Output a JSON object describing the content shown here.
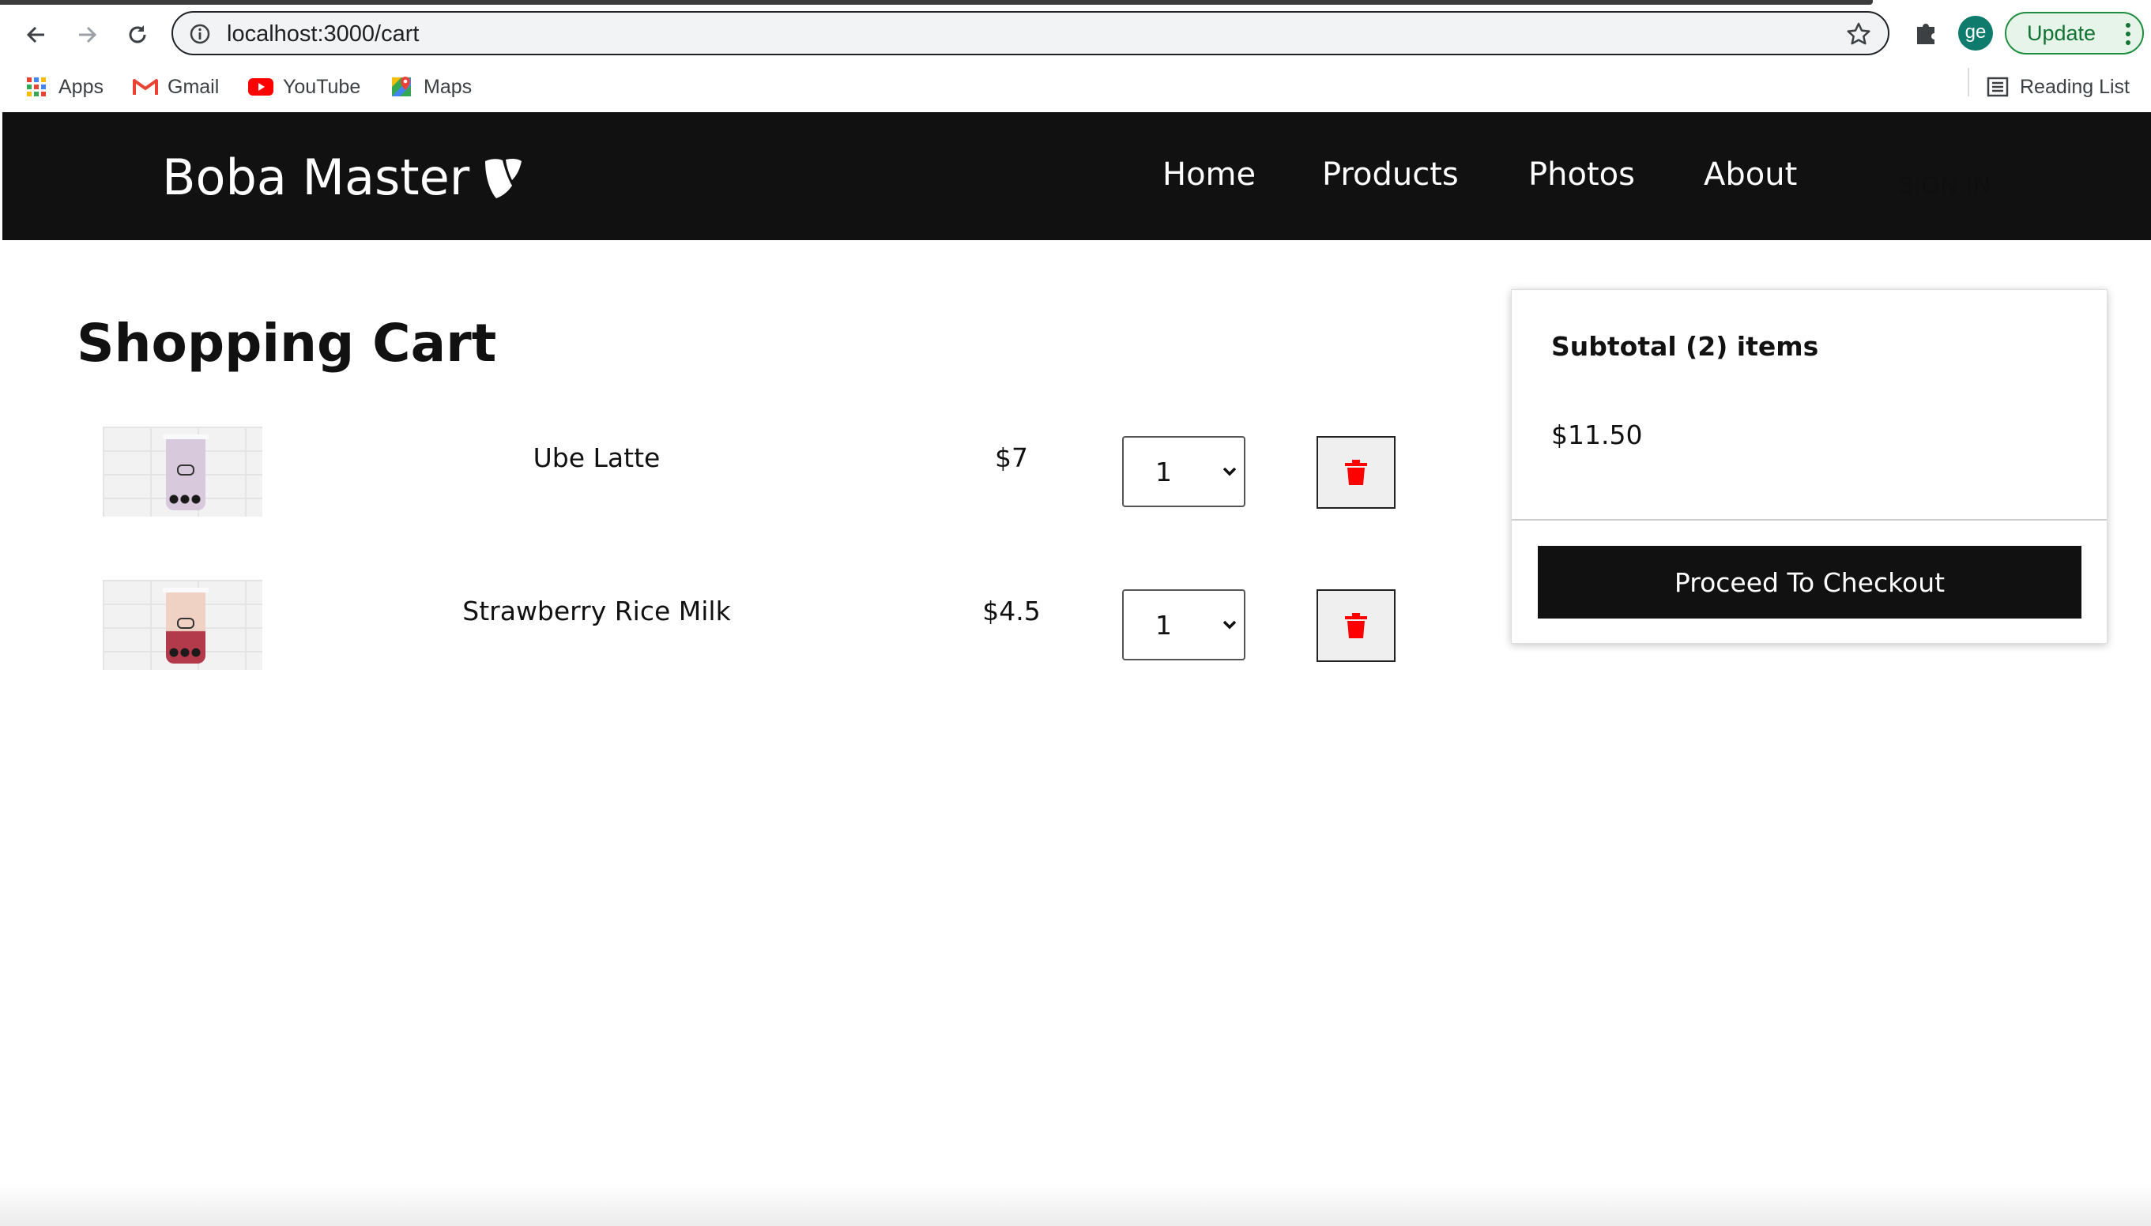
{
  "browser": {
    "url": "localhost:3000/cart",
    "profile_initials": "ge",
    "update_label": "Update",
    "bookmarks": [
      {
        "label": "Apps",
        "icon": "apps-grid-icon"
      },
      {
        "label": "Gmail",
        "icon": "gmail-icon"
      },
      {
        "label": "YouTube",
        "icon": "youtube-icon"
      },
      {
        "label": "Maps",
        "icon": "maps-icon"
      }
    ],
    "reading_list_label": "Reading List"
  },
  "header": {
    "brand": "Boba Master",
    "nav": [
      "Home",
      "Products",
      "Photos",
      "About"
    ],
    "sign_in": "SIGN IN"
  },
  "cart": {
    "title": "Shopping Cart",
    "items": [
      {
        "name": "Ube Latte",
        "price": "$7",
        "qty": "1",
        "drink_color": "#d9c9dc"
      },
      {
        "name": "Strawberry Rice Milk",
        "price": "$4.5",
        "qty": "1",
        "drink_color": "#f0d2c4"
      }
    ]
  },
  "summary": {
    "title": "Subtotal (2) items",
    "amount": "$11.50",
    "checkout_label": "Proceed To Checkout"
  },
  "colors": {
    "header_bg": "#111111",
    "delete_icon": "#ff0000",
    "checkout_bg": "#111111"
  }
}
